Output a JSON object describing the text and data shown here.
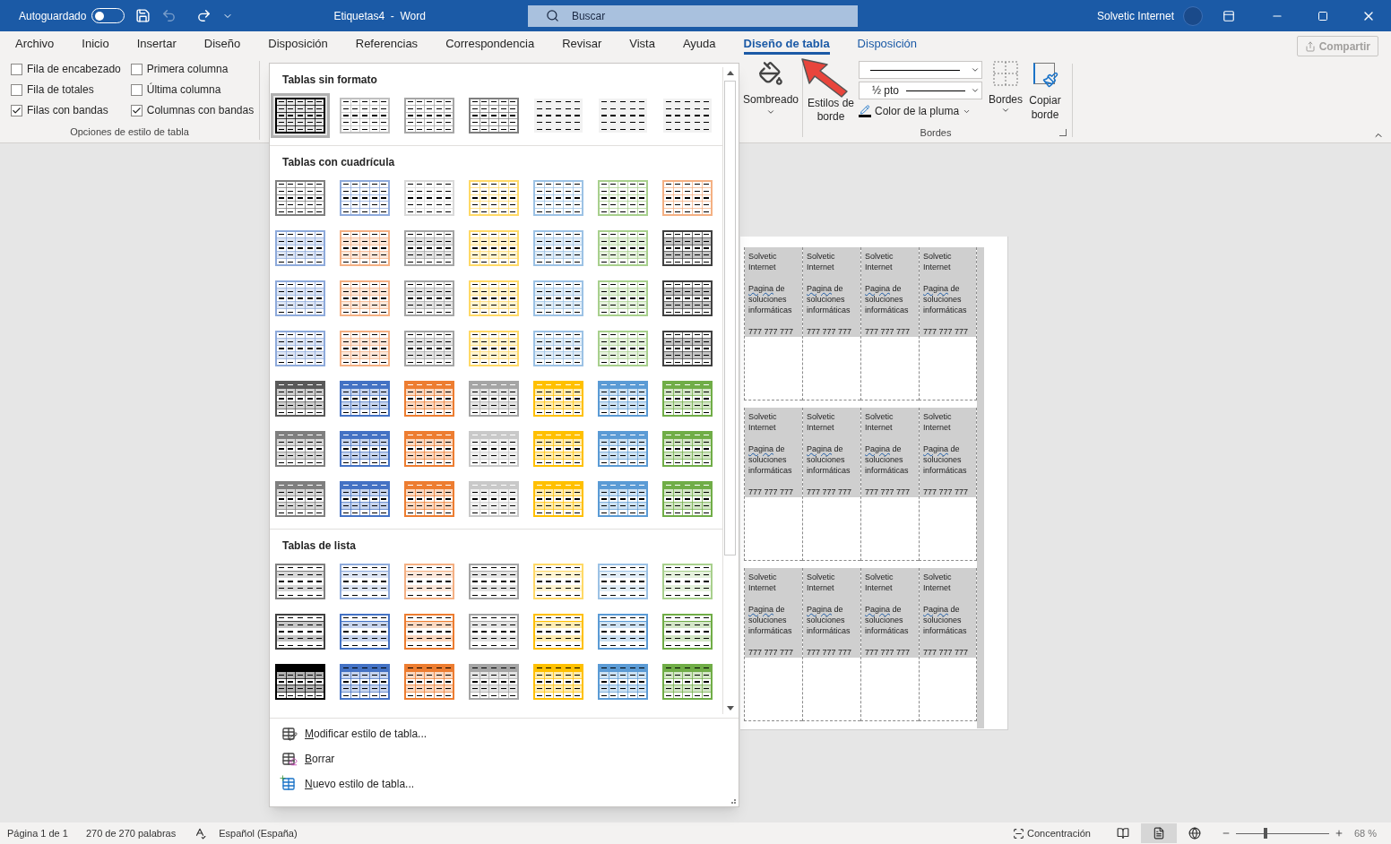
{
  "title_bar": {
    "autosave_label": "Autoguardado",
    "autosave_on": false,
    "document_title": "Etiquetas4  -  Word",
    "search_placeholder": "Buscar",
    "user_name": "Solvetic Internet"
  },
  "tabs": [
    {
      "label": "Archivo",
      "selected": false,
      "contextual": false
    },
    {
      "label": "Inicio",
      "selected": false,
      "contextual": false
    },
    {
      "label": "Insertar",
      "selected": false,
      "contextual": false
    },
    {
      "label": "Diseño",
      "selected": false,
      "contextual": false
    },
    {
      "label": "Disposición",
      "selected": false,
      "contextual": false
    },
    {
      "label": "Referencias",
      "selected": false,
      "contextual": false
    },
    {
      "label": "Correspondencia",
      "selected": false,
      "contextual": false
    },
    {
      "label": "Revisar",
      "selected": false,
      "contextual": false
    },
    {
      "label": "Vista",
      "selected": false,
      "contextual": false
    },
    {
      "label": "Ayuda",
      "selected": false,
      "contextual": false
    },
    {
      "label": "Diseño de tabla",
      "selected": true,
      "contextual": true
    },
    {
      "label": "Disposición",
      "selected": false,
      "contextual": true
    }
  ],
  "share_button": {
    "label": "Compartir",
    "disabled": true
  },
  "table_style_options": {
    "group_label": "Opciones de estilo de tabla",
    "columns": [
      [
        {
          "label": "Fila de encabezado",
          "checked": false
        },
        {
          "label": "Fila de totales",
          "checked": false
        },
        {
          "label": "Filas con bandas",
          "checked": true
        }
      ],
      [
        {
          "label": "Primera columna",
          "checked": false
        },
        {
          "label": "Última columna",
          "checked": false
        },
        {
          "label": "Columnas con bandas",
          "checked": true
        }
      ]
    ]
  },
  "gallery": {
    "sections": [
      {
        "title": "Tablas sin formato",
        "rows": [
          [
            {
              "kind": "grid",
              "color": "#000000",
              "selected": true
            },
            {
              "kind": "grid",
              "color": "#bfbfbf",
              "selected": false
            },
            {
              "kind": "grid",
              "color": "#a6a6a6",
              "selected": false
            },
            {
              "kind": "grid",
              "color": "#7f7f7f",
              "selected": false
            },
            {
              "kind": "plain",
              "color": "#f2f2f2",
              "selected": false
            },
            {
              "kind": "plain",
              "color": "#f2f2f2",
              "selected": false
            },
            {
              "kind": "plain",
              "color": "#f2f2f2",
              "selected": false
            }
          ]
        ]
      },
      {
        "title": "Tablas con cuadrícula",
        "rows": [
          [
            {
              "kind": "grid",
              "color": "#7f7f7f",
              "selected": false
            },
            {
              "kind": "grid",
              "color": "#8eaadb",
              "selected": false
            },
            {
              "kind": "grid",
              "color": "#d9d9d9",
              "selected": false
            },
            {
              "kind": "grid",
              "color": "#ffd966",
              "selected": false
            },
            {
              "kind": "grid",
              "color": "#9cc2e5",
              "selected": false
            },
            {
              "kind": "grid",
              "color": "#a8d08d",
              "selected": false
            },
            {
              "kind": "grid",
              "color": "#f4b083",
              "selected": false
            }
          ],
          [
            {
              "kind": "banded",
              "color": "#8eaadb",
              "selected": false
            },
            {
              "kind": "banded",
              "color": "#f4b083",
              "selected": false
            },
            {
              "kind": "banded",
              "color": "#a5a5a5",
              "selected": false
            },
            {
              "kind": "banded",
              "color": "#ffd966",
              "selected": false
            },
            {
              "kind": "banded",
              "color": "#9cc2e5",
              "selected": false
            },
            {
              "kind": "banded",
              "color": "#a8d08d",
              "selected": false
            },
            {
              "kind": "banded",
              "color": "#404040",
              "selected": false
            }
          ],
          [
            {
              "kind": "banded",
              "color": "#8eaadb",
              "selected": false
            },
            {
              "kind": "banded",
              "color": "#f4b083",
              "selected": false
            },
            {
              "kind": "banded",
              "color": "#a5a5a5",
              "selected": false
            },
            {
              "kind": "banded",
              "color": "#ffd966",
              "selected": false
            },
            {
              "kind": "banded",
              "color": "#9cc2e5",
              "selected": false
            },
            {
              "kind": "banded",
              "color": "#a8d08d",
              "selected": false
            },
            {
              "kind": "banded",
              "color": "#404040",
              "selected": false
            }
          ],
          [
            {
              "kind": "banded",
              "color": "#8eaadb",
              "selected": false
            },
            {
              "kind": "banded",
              "color": "#f4b083",
              "selected": false
            },
            {
              "kind": "banded",
              "color": "#a5a5a5",
              "selected": false
            },
            {
              "kind": "banded",
              "color": "#ffd966",
              "selected": false
            },
            {
              "kind": "banded",
              "color": "#9cc2e5",
              "selected": false
            },
            {
              "kind": "banded",
              "color": "#a8d08d",
              "selected": false
            },
            {
              "kind": "banded",
              "color": "#404040",
              "selected": false
            }
          ],
          [
            {
              "kind": "header",
              "color": "#595959",
              "selected": false
            },
            {
              "kind": "header",
              "color": "#4472c4",
              "selected": false
            },
            {
              "kind": "header",
              "color": "#ed7d31",
              "selected": false
            },
            {
              "kind": "header",
              "color": "#a5a5a5",
              "selected": false
            },
            {
              "kind": "header",
              "color": "#ffc000",
              "selected": false
            },
            {
              "kind": "header",
              "color": "#5b9bd5",
              "selected": false
            },
            {
              "kind": "header",
              "color": "#70ad47",
              "selected": false
            }
          ],
          [
            {
              "kind": "header",
              "color": "#7f7f7f",
              "selected": false
            },
            {
              "kind": "header",
              "color": "#4472c4",
              "selected": false
            },
            {
              "kind": "header",
              "color": "#ed7d31",
              "selected": false
            },
            {
              "kind": "header",
              "color": "#c9c9c9",
              "selected": false
            },
            {
              "kind": "header",
              "color": "#ffc000",
              "selected": false
            },
            {
              "kind": "header",
              "color": "#5b9bd5",
              "selected": false
            },
            {
              "kind": "header",
              "color": "#70ad47",
              "selected": false
            }
          ],
          [
            {
              "kind": "header",
              "color": "#7f7f7f",
              "selected": false
            },
            {
              "kind": "header",
              "color": "#4472c4",
              "selected": false
            },
            {
              "kind": "header",
              "color": "#ed7d31",
              "selected": false
            },
            {
              "kind": "header",
              "color": "#c9c9c9",
              "selected": false
            },
            {
              "kind": "header",
              "color": "#ffc000",
              "selected": false
            },
            {
              "kind": "header",
              "color": "#5b9bd5",
              "selected": false
            },
            {
              "kind": "header",
              "color": "#70ad47",
              "selected": false
            }
          ]
        ]
      },
      {
        "title": "Tablas de lista",
        "rows": [
          [
            {
              "kind": "list",
              "color": "#7f7f7f",
              "selected": false
            },
            {
              "kind": "list",
              "color": "#8eaadb",
              "selected": false
            },
            {
              "kind": "list",
              "color": "#f4b083",
              "selected": false
            },
            {
              "kind": "list",
              "color": "#a5a5a5",
              "selected": false
            },
            {
              "kind": "list",
              "color": "#ffd966",
              "selected": false
            },
            {
              "kind": "list",
              "color": "#9cc2e5",
              "selected": false
            },
            {
              "kind": "list",
              "color": "#a8d08d",
              "selected": false
            }
          ],
          [
            {
              "kind": "list",
              "color": "#404040",
              "selected": false
            },
            {
              "kind": "list",
              "color": "#4472c4",
              "selected": false
            },
            {
              "kind": "list",
              "color": "#ed7d31",
              "selected": false
            },
            {
              "kind": "list",
              "color": "#a5a5a5",
              "selected": false
            },
            {
              "kind": "list",
              "color": "#ffc000",
              "selected": false
            },
            {
              "kind": "list",
              "color": "#5b9bd5",
              "selected": false
            },
            {
              "kind": "list",
              "color": "#70ad47",
              "selected": false
            }
          ],
          [
            {
              "kind": "outline",
              "color": "#000000",
              "selected": false
            },
            {
              "kind": "outline",
              "color": "#4472c4",
              "selected": false
            },
            {
              "kind": "outline",
              "color": "#ed7d31",
              "selected": false
            },
            {
              "kind": "outline",
              "color": "#a5a5a5",
              "selected": false
            },
            {
              "kind": "outline",
              "color": "#ffc000",
              "selected": false
            },
            {
              "kind": "outline",
              "color": "#5b9bd5",
              "selected": false
            },
            {
              "kind": "outline",
              "color": "#70ad47",
              "selected": false
            }
          ]
        ]
      }
    ],
    "menu": [
      {
        "kind": "modify",
        "label": "Modificar estilo de tabla..."
      },
      {
        "kind": "clear",
        "label": "Borrar"
      },
      {
        "kind": "new",
        "label": "Nuevo estilo de tabla..."
      }
    ]
  },
  "borders_group": {
    "shading_label": "Sombreado",
    "border_styles_label": "Estilos de borde",
    "pen_weight": "½ pto",
    "pen_color_label": "Color de la pluma",
    "borders_label": "Bordes",
    "copy_border_label": "Copiar borde",
    "group_label": "Bordes"
  },
  "document": {
    "label_rows": [
      [
        {
          "name": "Solvetic Internet",
          "flagged_word": "Pagina",
          "rest": "de soluciones informáticas",
          "phone": "777 777 777"
        },
        {
          "name": "Solvetic Internet",
          "flagged_word": "Pagina",
          "rest": "de soluciones informáticas",
          "phone": "777 777 777"
        },
        {
          "name": "Solvetic Internet",
          "flagged_word": "Pagina",
          "rest": "de soluciones informáticas",
          "phone": "777 777 777"
        },
        {
          "name": "Solvetic Internet",
          "flagged_word": "Pagina",
          "rest": "de soluciones informáticas",
          "phone": "777 777 777"
        }
      ],
      [
        {
          "name": "Solvetic Internet",
          "flagged_word": "Pagina",
          "rest": "de soluciones informáticas",
          "phone": "777 777 777"
        },
        {
          "name": "Solvetic Internet",
          "flagged_word": "Pagina",
          "rest": "de soluciones informáticas",
          "phone": "777 777 777"
        },
        {
          "name": "Solvetic Internet",
          "flagged_word": "Pagina",
          "rest": "de soluciones informáticas",
          "phone": "777 777 777"
        },
        {
          "name": "Solvetic Internet",
          "flagged_word": "Pagina",
          "rest": "de soluciones informáticas",
          "phone": "777 777 777"
        }
      ],
      [
        {
          "name": "Solvetic Internet",
          "flagged_word": "Pagina",
          "rest": "de soluciones informáticas",
          "phone": "777 777 777"
        },
        {
          "name": "Solvetic Internet",
          "flagged_word": "Pagina",
          "rest": "de soluciones informáticas",
          "phone": "777 777 777"
        },
        {
          "name": "Solvetic Internet",
          "flagged_word": "Pagina",
          "rest": "de soluciones informáticas",
          "phone": "777 777 777"
        },
        {
          "name": "Solvetic Internet",
          "flagged_word": "Pagina",
          "rest": "de soluciones informáticas",
          "phone": "777 777 777"
        }
      ]
    ]
  },
  "status_bar": {
    "page": "Página 1 de 1",
    "words": "270 de 270 palabras",
    "language": "Español (España)",
    "focus": "Concentración",
    "views": [
      {
        "kind": "read",
        "selected": false
      },
      {
        "kind": "print",
        "selected": true
      },
      {
        "kind": "web",
        "selected": false
      }
    ],
    "zoom": {
      "level": 0.32,
      "reading": "68 %"
    }
  }
}
